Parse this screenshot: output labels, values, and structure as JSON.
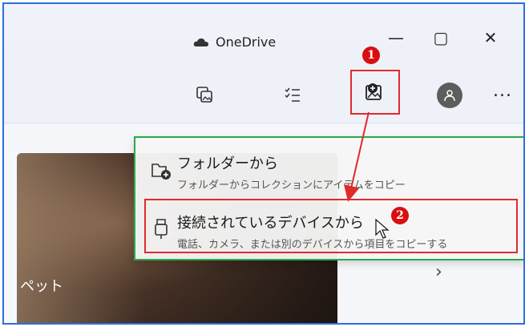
{
  "window": {
    "title": "OneDrive",
    "controls": {
      "minimize": "—",
      "maximize": "▢",
      "close": "✕"
    }
  },
  "toolbar": {
    "more": "..."
  },
  "markers": {
    "one": "1",
    "two": "2"
  },
  "menu": {
    "items": [
      {
        "title": "フォルダーから",
        "desc": "フォルダーからコレクションにアイテムをコピー"
      },
      {
        "title": "接続されているデバイスから",
        "desc": "電話、カメラ、または別のデバイスから項目をコピーする"
      }
    ]
  },
  "album": {
    "label": "ペット",
    "next": "›"
  },
  "colors": {
    "frame": "#2f6fd8",
    "highlight_red": "#e12b2b",
    "menu_border": "#2ba84a",
    "marker": "#d90f0f"
  },
  "icons": [
    "cloud-icon",
    "gallery-icon",
    "checklist-icon",
    "import-icon",
    "avatar-icon",
    "folder-add-icon",
    "usb-device-icon",
    "cursor-icon"
  ]
}
